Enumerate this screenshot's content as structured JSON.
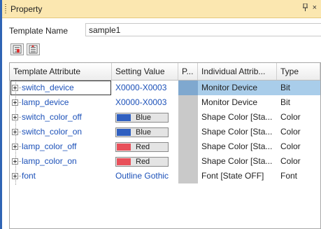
{
  "panel": {
    "title": "Property",
    "pin_glyph": "ᴩ",
    "close_glyph": "×"
  },
  "template": {
    "label": "Template Name",
    "value": "sample1"
  },
  "toolbar": {
    "icons": [
      "categorize-icon",
      "sort-icon"
    ]
  },
  "grid": {
    "columns": [
      "Template Attribute",
      "Setting Value",
      "P...",
      "Individual Attrib...",
      "Type"
    ],
    "rows": [
      {
        "attribute": "switch_device",
        "setting": "X0000-X0003",
        "individual": "Monitor Device",
        "type": "Bit",
        "selected": true
      },
      {
        "attribute": "lamp_device",
        "setting": "X0000-X0003",
        "individual": "Monitor Device",
        "type": "Bit"
      },
      {
        "attribute": "switch_color_off",
        "setting": "Blue",
        "swatch": "#2f5fc0",
        "individual": "Shape Color [Sta...",
        "type": "Color"
      },
      {
        "attribute": "switch_color_on",
        "setting": "Blue",
        "swatch": "#2f5fc0",
        "individual": "Shape Color [Sta...",
        "type": "Color"
      },
      {
        "attribute": "lamp_color_off",
        "setting": "Red",
        "swatch": "#e8505a",
        "individual": "Shape Color [Sta...",
        "type": "Color"
      },
      {
        "attribute": "lamp_color_on",
        "setting": "Red",
        "swatch": "#e8505a",
        "individual": "Shape Color [Sta...",
        "type": "Color"
      },
      {
        "attribute": "font",
        "setting": "Outline Gothic",
        "individual": "Font [State OFF]",
        "type": "Font"
      }
    ]
  },
  "colors": {
    "accent": "#2f64b4",
    "titlebar": "#fbe7b0",
    "selection": "#a9cdea",
    "link_text": "#1b50b8"
  }
}
